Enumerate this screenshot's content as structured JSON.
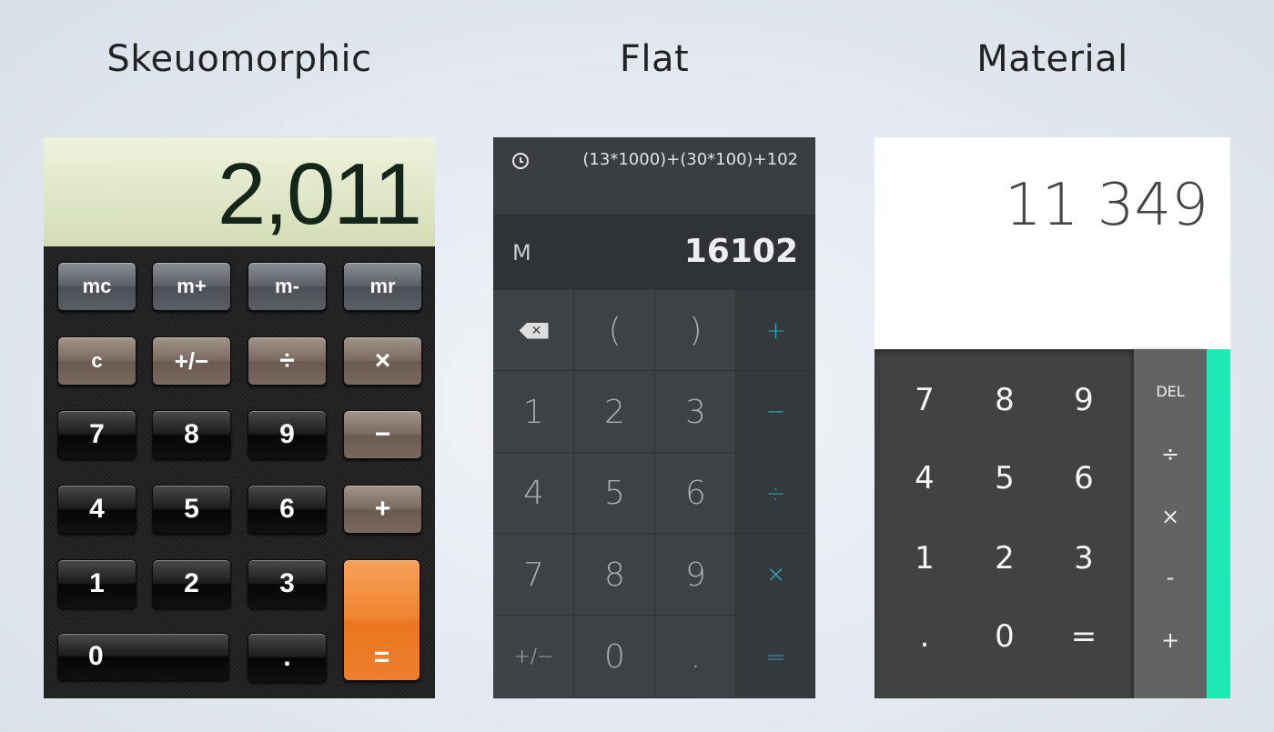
{
  "headings": {
    "skeuomorphic": "Skeuomorphic",
    "flat": "Flat",
    "material": "Material"
  },
  "skeuomorphic": {
    "display": "2,011",
    "keys": [
      "mc",
      "m+",
      "m-",
      "mr",
      "c",
      "+/−",
      "÷",
      "×",
      "7",
      "8",
      "9",
      "−",
      "4",
      "5",
      "6",
      "+",
      "1",
      "2",
      "3",
      "=",
      "0",
      "."
    ]
  },
  "flat": {
    "expression": "(13*1000)+(30*100)+102",
    "memory": "M",
    "result": "16102",
    "icons": {
      "history": "clock-icon",
      "backspace": "backspace-icon"
    },
    "keys": [
      "(",
      ")",
      "+",
      "1",
      "2",
      "3",
      "−",
      "4",
      "5",
      "6",
      "÷",
      "7",
      "8",
      "9",
      "×",
      "+/−",
      "0",
      ".",
      "="
    ],
    "backspace_glyph": "✕",
    "accent_color": "#36a7c9"
  },
  "material": {
    "display": "11 349",
    "digits": [
      "7",
      "8",
      "9",
      "4",
      "5",
      "6",
      "1",
      "2",
      "3",
      ".",
      "0",
      "="
    ],
    "ops": [
      "DEL",
      "÷",
      "×",
      "-",
      "+"
    ],
    "accent_color": "#1de9b6"
  }
}
